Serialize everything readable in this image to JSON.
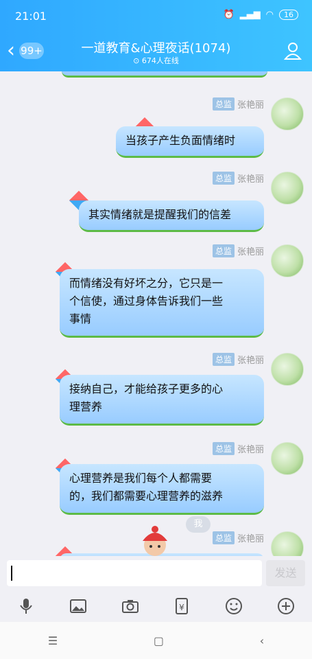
{
  "status": {
    "time": "21:01",
    "battery": "16"
  },
  "header": {
    "back_badge": "99+",
    "title": "一道教育&心理夜话(1074)",
    "online": "674人在线"
  },
  "messages": [
    {
      "tag": "总监",
      "name": "张艳丽",
      "lines": [
        "当孩子产生负面情绪时"
      ]
    },
    {
      "tag": "总监",
      "name": "张艳丽",
      "lines": [
        "其实情绪就是提醒我们的信差"
      ]
    },
    {
      "tag": "总监",
      "name": "张艳丽",
      "lines": [
        "而情绪没有好坏之分，它只是一",
        "个信使，通过身体告诉我们一些",
        "事情"
      ]
    },
    {
      "tag": "总监",
      "name": "张艳丽",
      "lines": [
        "接纳自己，才能给孩子更多的心",
        "理营养"
      ]
    },
    {
      "tag": "总监",
      "name": "张艳丽",
      "lines": [
        "心理营养是我们每个人都需要",
        "的，我们都需要心理营养的滋养"
      ]
    },
    {
      "tag": "总监",
      "name": "张艳丽",
      "lines": []
    }
  ],
  "peek_label": "我",
  "input": {
    "send_label": "发送"
  },
  "icons": [
    "microphone-icon",
    "image-icon",
    "camera-icon",
    "red-packet-icon",
    "emoji-icon",
    "plus-icon"
  ]
}
